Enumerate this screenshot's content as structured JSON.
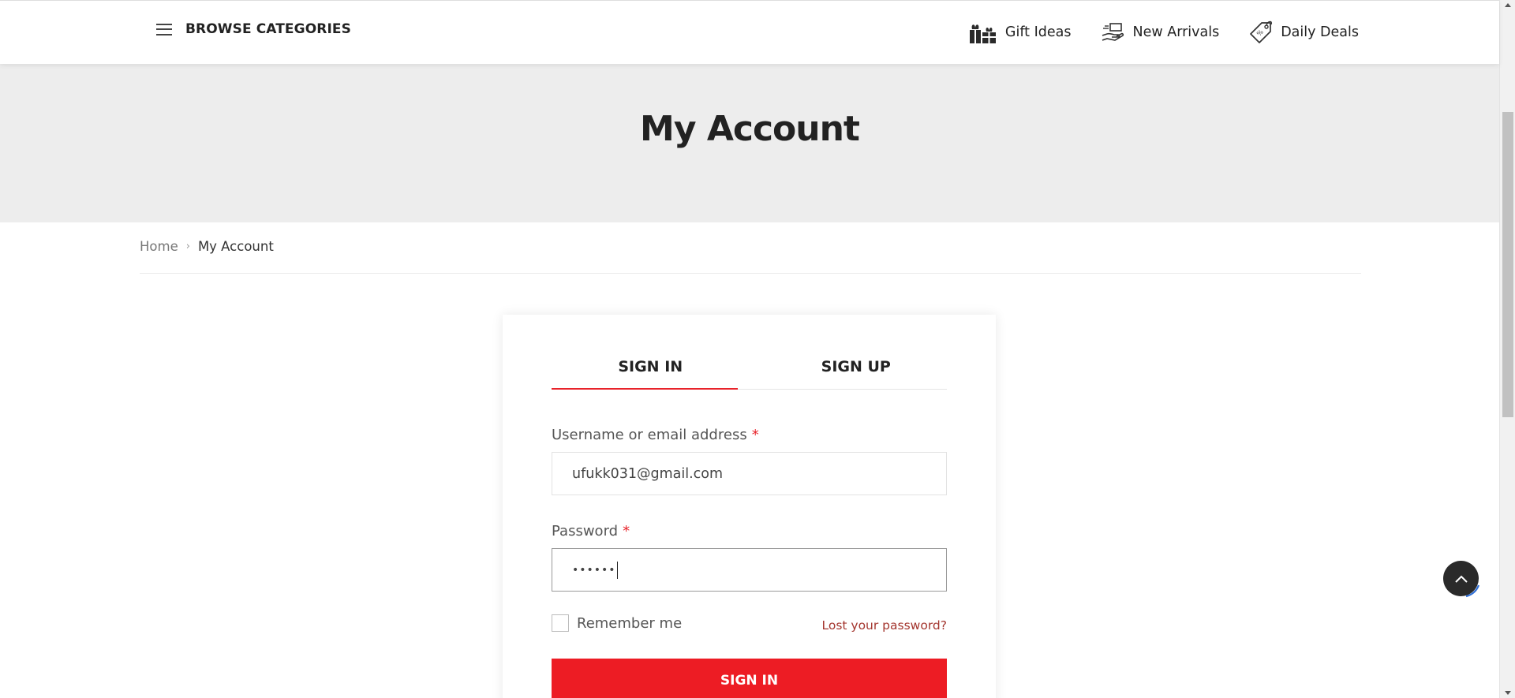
{
  "header": {
    "browse_label": "BROWSE CATEGORIES",
    "nav": [
      {
        "label": "Gift Ideas",
        "icon": "gift-icon"
      },
      {
        "label": "New Arrivals",
        "icon": "delivery-hand-icon"
      },
      {
        "label": "Daily Deals",
        "icon": "price-tag-icon"
      }
    ]
  },
  "hero": {
    "title": "My Account"
  },
  "breadcrumb": {
    "home": "Home",
    "separator": "›",
    "current": "My Account"
  },
  "login": {
    "tabs": [
      {
        "label": "SIGN IN",
        "active": true
      },
      {
        "label": "SIGN UP",
        "active": false
      }
    ],
    "username_label": "Username or email address",
    "username_value": "ufukk031@gmail.com",
    "password_label": "Password",
    "password_value": "••••••",
    "required_mark": "*",
    "remember_label": "Remember me",
    "remember_checked": false,
    "lost_password": "Lost your password?",
    "submit_label": "SIGN IN"
  },
  "colors": {
    "accent": "#ed1c24",
    "hero_bg": "#ededed",
    "link": "#a4362f",
    "dark": "#2a2a2a"
  }
}
